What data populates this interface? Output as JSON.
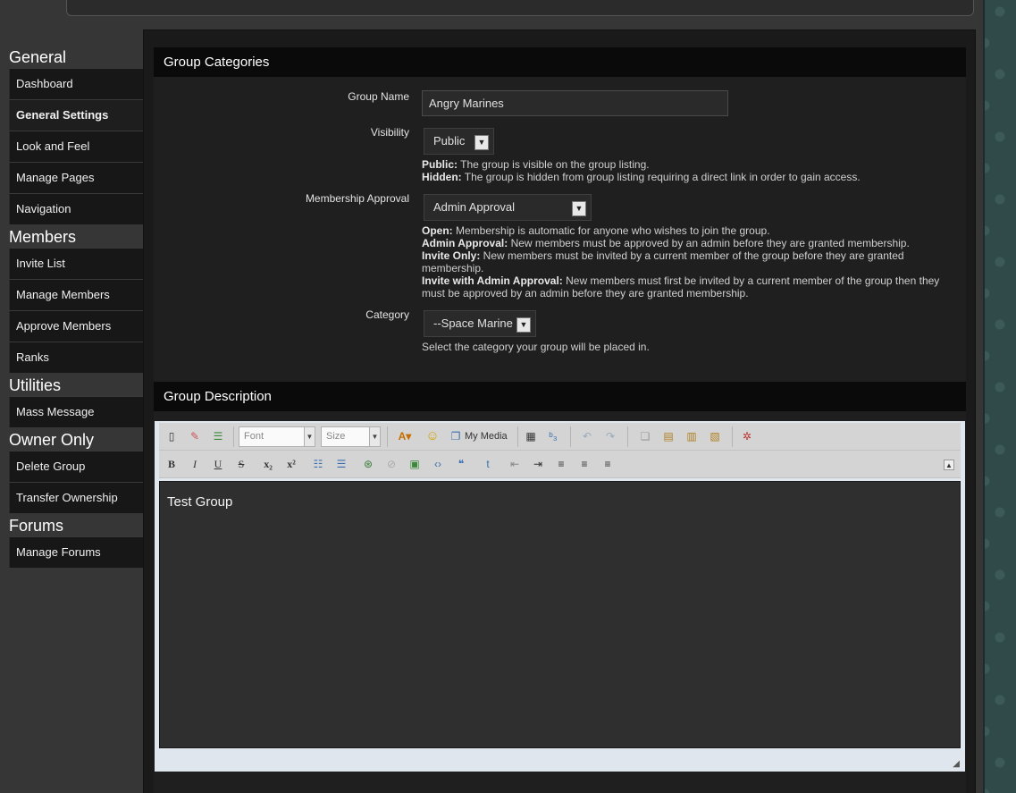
{
  "sidebar": {
    "groups": [
      {
        "heading": "General",
        "items": [
          "Dashboard",
          "General Settings",
          "Look and Feel",
          "Manage Pages",
          "Navigation"
        ]
      },
      {
        "heading": "Members",
        "items": [
          "Invite List",
          "Manage Members",
          "Approve Members",
          "Ranks"
        ]
      },
      {
        "heading": "Utilities",
        "items": [
          "Mass Message"
        ]
      },
      {
        "heading": "Owner Only",
        "items": [
          "Delete Group",
          "Transfer Ownership"
        ]
      },
      {
        "heading": "Forums",
        "items": [
          "Manage Forums"
        ]
      }
    ]
  },
  "form": {
    "section_title": "Group Categories",
    "group_name_label": "Group Name",
    "group_name_value": "Angry Marines",
    "visibility_label": "Visibility",
    "visibility_value": "Public",
    "visibility_help": [
      {
        "term": "Public:",
        "text": " The group is visible on the group listing."
      },
      {
        "term": "Hidden:",
        "text": " The group is hidden from group listing requiring a direct link in order to gain access."
      }
    ],
    "membership_label": "Membership Approval",
    "membership_value": "Admin Approval",
    "membership_help": [
      {
        "term": "Open:",
        "text": " Membership is automatic for anyone who wishes to join the group."
      },
      {
        "term": "Admin Approval:",
        "text": " New members must be approved by an admin before they are granted membership."
      },
      {
        "term": "Invite Only:",
        "text": " New members must be invited by a current member of the group before they are granted membership."
      },
      {
        "term": "Invite with Admin Approval:",
        "text": " New members must first be invited by a current member of the group then they must be approved by an admin before they are granted membership."
      }
    ],
    "category_label": "Category",
    "category_value": "--Space Marine",
    "category_help": "Select the category your group will be placed in."
  },
  "description": {
    "section_title": "Group Description",
    "font_placeholder": "Font",
    "size_placeholder": "Size",
    "my_media_label": "My Media",
    "content": "Test Group"
  }
}
